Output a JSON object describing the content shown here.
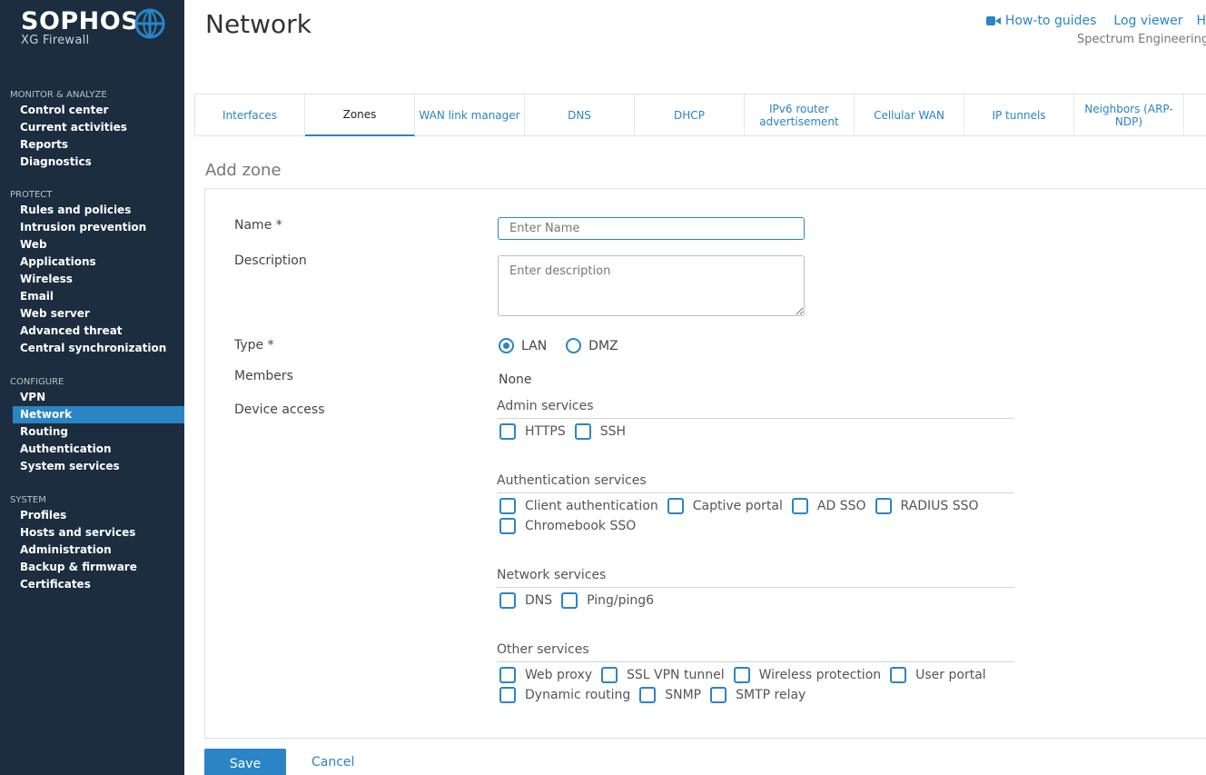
{
  "brand": {
    "name": "SOPHOS",
    "product": "XG Firewall"
  },
  "sidebar": {
    "sections": [
      {
        "heading": "MONITOR & ANALYZE",
        "items": [
          "Control center",
          "Current activities",
          "Reports",
          "Diagnostics"
        ]
      },
      {
        "heading": "PROTECT",
        "items": [
          "Rules and policies",
          "Intrusion prevention",
          "Web",
          "Applications",
          "Wireless",
          "Email",
          "Web server",
          "Advanced threat",
          "Central synchronization"
        ]
      },
      {
        "heading": "CONFIGURE",
        "items": [
          "VPN",
          "Network",
          "Routing",
          "Authentication",
          "System services"
        ]
      },
      {
        "heading": "SYSTEM",
        "items": [
          "Profiles",
          "Hosts and services",
          "Administration",
          "Backup & firmware",
          "Certificates"
        ]
      }
    ],
    "active_item": "Network"
  },
  "header": {
    "title": "Network",
    "links": {
      "howto": "How-to guides",
      "log_viewer": "Log viewer",
      "help": "H"
    },
    "org": "Spectrum Engineering"
  },
  "tabs": [
    {
      "label": "Interfaces",
      "active": false
    },
    {
      "label": "Zones",
      "active": true
    },
    {
      "label": "WAN link manager",
      "active": false
    },
    {
      "label": "DNS",
      "active": false
    },
    {
      "label": "DHCP",
      "active": false
    },
    {
      "label": "IPv6 router advertisement",
      "active": false
    },
    {
      "label": "Cellular WAN",
      "active": false
    },
    {
      "label": "IP tunnels",
      "active": false
    },
    {
      "label": "Neighbors (ARP-NDP)",
      "active": false
    }
  ],
  "form": {
    "section_title": "Add zone",
    "name_label": "Name *",
    "name_placeholder": "Enter Name",
    "name_value": "",
    "description_label": "Description",
    "description_placeholder": "Enter description",
    "type_label": "Type *",
    "type_options": [
      "LAN",
      "DMZ"
    ],
    "type_selected": "LAN",
    "members_label": "Members",
    "members_value": "None",
    "device_access_label": "Device access",
    "groups": [
      {
        "title": "Admin services",
        "options": [
          [
            "HTTPS",
            "SSH"
          ]
        ]
      },
      {
        "title": "Authentication services",
        "options": [
          [
            "Client authentication",
            "Captive portal",
            "AD SSO",
            "RADIUS SSO"
          ],
          [
            "Chromebook SSO"
          ]
        ]
      },
      {
        "title": "Network services",
        "options": [
          [
            "DNS",
            "Ping/ping6"
          ]
        ]
      },
      {
        "title": "Other services",
        "options": [
          [
            "Web proxy",
            "SSL VPN tunnel",
            "Wireless protection",
            "User portal"
          ],
          [
            "Dynamic routing",
            "SNMP",
            "SMTP relay"
          ]
        ]
      }
    ],
    "save_label": "Save",
    "cancel_label": "Cancel"
  },
  "colors": {
    "sidebar_bg": "#1b2d3f",
    "accent": "#2b84c6"
  }
}
